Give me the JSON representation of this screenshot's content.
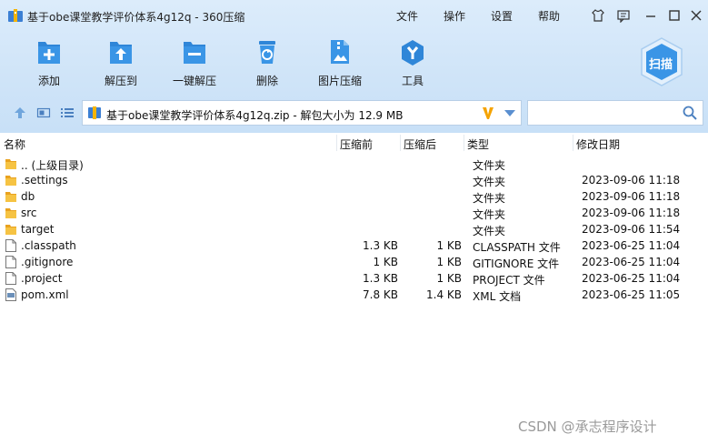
{
  "window": {
    "title": "基于obe课堂教学评价体系4g12q - 360压缩"
  },
  "menu": [
    "文件",
    "操作",
    "设置",
    "帮助"
  ],
  "toolbar": [
    {
      "label": "添加",
      "icon": "add-icon"
    },
    {
      "label": "解压到",
      "icon": "extract-to-icon"
    },
    {
      "label": "一键解压",
      "icon": "one-click-extract-icon"
    },
    {
      "label": "删除",
      "icon": "delete-icon"
    },
    {
      "label": "图片压缩",
      "icon": "image-compress-icon"
    },
    {
      "label": "工具",
      "icon": "tools-icon"
    }
  ],
  "scan_label": "扫描",
  "path": {
    "text": "基于obe课堂教学评价体系4g12q.zip - 解包大小为 12.9 MB"
  },
  "search": {
    "placeholder": "",
    "value": ""
  },
  "columns": [
    "名称",
    "压缩前",
    "压缩后",
    "类型",
    "修改日期"
  ],
  "rows": [
    {
      "name": ".. (上级目录)",
      "orig": "",
      "comp": "",
      "type": "文件夹",
      "date": "",
      "kind": "folder"
    },
    {
      "name": ".settings",
      "orig": "",
      "comp": "",
      "type": "文件夹",
      "date": "2023-09-06 11:18",
      "kind": "folder"
    },
    {
      "name": "db",
      "orig": "",
      "comp": "",
      "type": "文件夹",
      "date": "2023-09-06 11:18",
      "kind": "folder"
    },
    {
      "name": "src",
      "orig": "",
      "comp": "",
      "type": "文件夹",
      "date": "2023-09-06 11:18",
      "kind": "folder"
    },
    {
      "name": "target",
      "orig": "",
      "comp": "",
      "type": "文件夹",
      "date": "2023-09-06 11:54",
      "kind": "folder"
    },
    {
      "name": ".classpath",
      "orig": "1.3 KB",
      "comp": "1 KB",
      "type": "CLASSPATH 文件",
      "date": "2023-06-25 11:04",
      "kind": "file"
    },
    {
      "name": ".gitignore",
      "orig": "1 KB",
      "comp": "1 KB",
      "type": "GITIGNORE 文件",
      "date": "2023-06-25 11:04",
      "kind": "file"
    },
    {
      "name": ".project",
      "orig": "1.3 KB",
      "comp": "1 KB",
      "type": "PROJECT 文件",
      "date": "2023-06-25 11:04",
      "kind": "file"
    },
    {
      "name": "pom.xml",
      "orig": "7.8 KB",
      "comp": "1.4 KB",
      "type": "XML 文档",
      "date": "2023-06-25 11:05",
      "kind": "xml"
    }
  ],
  "watermark": "CSDN @承志程序设计",
  "colors": {
    "toolbar_bg": "#cfe4f8",
    "icon_blue": "#2f86d8",
    "folder": "#f0b429",
    "accent": "#f5a300"
  }
}
